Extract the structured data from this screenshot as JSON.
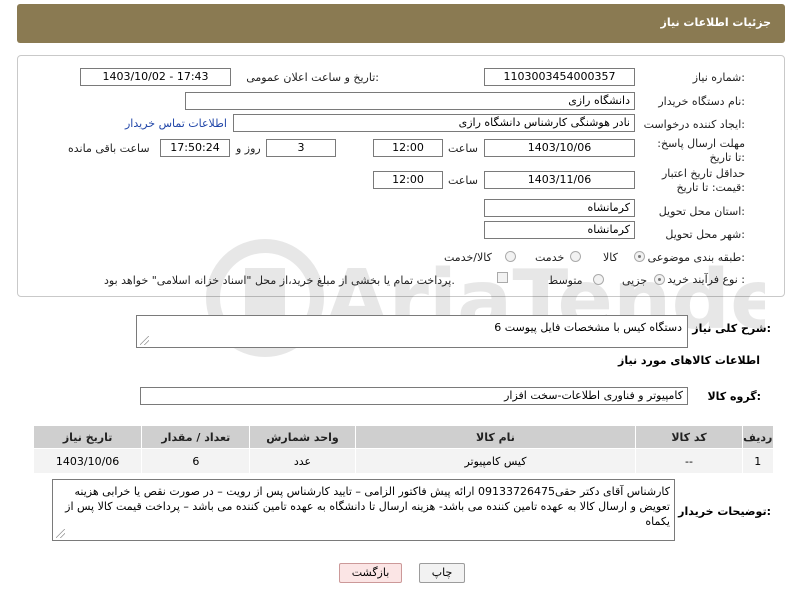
{
  "header": {
    "title": "جزئیات اطلاعات نیاز"
  },
  "form": {
    "need_number_label": "شماره نیاز:",
    "need_number": "1103003454000357",
    "announce_label": "تاریخ و ساعت اعلان عمومی:",
    "announce_value": "1403/10/02 - 17:43",
    "buyer_org_label": "نام دستگاه خریدار:",
    "buyer_org": "دانشگاه رازی",
    "creator_label": "ایجاد کننده درخواست:",
    "creator": "نادر هوشنگی کارشناس دانشگاه رازی",
    "contact_link": "اطلاعات تماس خریدار",
    "deadline_label": "مهلت ارسال پاسخ: تا تاریخ:",
    "deadline_date": "1403/10/06",
    "time_label": "ساعت",
    "deadline_time": "12:00",
    "days_value": "3",
    "days_label": "روز و",
    "remaining_time": "17:50:24",
    "remaining_label": "ساعت باقی مانده",
    "validity_label": "حداقل تاریخ اعتبار قیمت: تا تاریخ:",
    "validity_date": "1403/11/06",
    "validity_time": "12:00",
    "province_label": "استان محل تحویل:",
    "province": "کرمانشاه",
    "city_label": "شهر محل تحویل:",
    "city": "کرمانشاه",
    "category_label": "طبقه بندی موضوعی:",
    "cat_goods": "کالا",
    "cat_service": "خدمت",
    "cat_both": "کالا/خدمت",
    "purchase_label": "نوع فرآیند خرید :",
    "proc_partial": "جزیی",
    "proc_medium": "متوسط",
    "payment_note": "پرداخت تمام یا بخشی از مبلغ خرید،از محل \"اسناد خزانه اسلامی\" خواهد بود."
  },
  "desc": {
    "label": "شرح کلی نیاز:",
    "value": "6 دستگاه کیس با مشخصات فایل پیوست"
  },
  "goods_title": "اطلاعات کالاهای مورد نیاز",
  "group": {
    "label": "گروه کالا:",
    "value": "کامپیوتر و فناوری اطلاعات-سخت افزار"
  },
  "table": {
    "headers": [
      "ردیف",
      "کد کالا",
      "نام کالا",
      "واحد شمارش",
      "تعداد / مقدار",
      "تاریخ نیاز"
    ],
    "rows": [
      [
        "1",
        "--",
        "کیس کامپیوتر",
        "عدد",
        "6",
        "1403/10/06"
      ]
    ]
  },
  "buyer_notes": {
    "label": "توضیحات خریدار:",
    "text": "کارشناس آقای دکتر حقی09133726475 ارائه پیش فاکتور الزامی – تایید کارشناس پس از رویت – در صورت نقص یا خرابی هزینه تعویض و ارسال کالا به عهده تامین کننده می باشد- هزینه ارسال تا دانشگاه به عهده تامین کننده می باشد – پرداخت قیمت کالا پس از یکماه"
  },
  "buttons": {
    "print": "چاپ",
    "back": "بازگشت"
  },
  "colors": {
    "header": "#8a7a52",
    "back_button_bg": "#fbe5e5",
    "link": "#2146a8"
  }
}
